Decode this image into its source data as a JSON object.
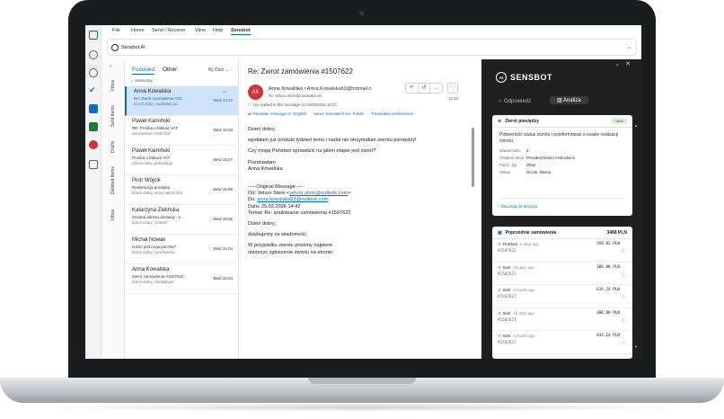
{
  "menubar": {
    "items": [
      "File",
      "Home",
      "Send / Receive",
      "View",
      "Help",
      "Sensbot"
    ],
    "active": "Sensbot"
  },
  "ribbon": {
    "button_label": "Sensbot AI"
  },
  "folders": [
    "Inbox",
    "Sent Items",
    "Drafts",
    "Deleted Items",
    "Inbox"
  ],
  "message_list": {
    "tab_focused": "Focused",
    "tab_other": "Other",
    "sort": "By Date ⌄",
    "group": "Yesterday",
    "items": [
      {
        "sender": "Anna Kowalska",
        "subject": "Re: Zwrot zamówienia #15...",
        "preview": "Dzień dobry, wysłałam juz",
        "date": "Wed 13:42"
      },
      {
        "sender": "Paweł Kamiński",
        "subject": "RE: Prośba o fakturę VAT",
        "preview": "zamówienie #1507301",
        "date": "Wed 15:08"
      },
      {
        "sender": "Paweł Kamiński",
        "subject": "Prośba o fakturę VAT",
        "preview": "Dzień dobry, potrzebuję",
        "date": "Wed 15:07"
      },
      {
        "sender": "Piotr Wójcik",
        "subject": "Reklamacja produktu",
        "preview": "Dzień dobry, otrzymałem dziś",
        "date": "Wed 15:06"
      },
      {
        "sender": "Katarzyna Zielińska",
        "subject": "Zmiana adresu dostawy - z...",
        "preview": "Dzień dobry, zmienić",
        "date": "Wed 15:05"
      },
      {
        "sender": "Michał Nowak",
        "subject": "Gdzie jest moja paczka?",
        "preview": "Dzień dobry, zamówienie",
        "date": "Wed 15:04"
      },
      {
        "sender": "Anna Kowalska",
        "subject": "Zwrot zamówienia #1507622",
        "preview": "Dzień dobry, chciałabym",
        "date": "Wed 15:04"
      }
    ]
  },
  "reading": {
    "subject": "Re: Zwrot zamówienia #1507622",
    "avatar_initials": "AK",
    "from": "Anna Kowalska <Anna.Kowalska63@hotmail.c",
    "to": "To: veluro.store@outlook.com",
    "time": "13:42",
    "replied_info": "You replied to this message on 04/03/2026 18:27.",
    "translate_link": "Translate message to: English",
    "never_translate": "Never translate from: Polish",
    "translation_prefs": "Translation preferences",
    "body": {
      "p1": "Dzień dobry,",
      "p2": "wysłałam już produkt tydzień temu i nadal nie otrzymałam zwrotu pieniędzy!",
      "p3": "Czy mogą Państwo sprawdzić na jakim etapie jest zwrot?",
      "p4a": "Pozdrawiam",
      "p4b": "Anna Kowalska",
      "orig_hdr": "-----Original Message-----",
      "od_label": "Od: Veluro Store <",
      "od_email": "veluro.store@outlook.com",
      "od_end": ">",
      "do_label": "Do: ",
      "do_email": "anna.kowalska63@outlook.com",
      "data": "Data: 25.02.2026 14:42",
      "temat": "Temat: Re: anulowanie zamówienia #1507622",
      "p5": "Dzień dobry,",
      "p6": "dziękujemy za wiadomość.",
      "p7a": "W przypadku zwrotu prosimy najpierw",
      "p7b": "utworzyć zgłoszenie zwrotu na stronie:"
    }
  },
  "sensbot": {
    "logo_mark": "AI",
    "logo_text": "SENSBOT",
    "tab_reply": "☆ Odpowiedz",
    "tab_analysis": "▥ Analiza",
    "card1": {
      "title": "Zwrot pieniędzy",
      "badge": "Niski",
      "text": "Potwierdzić status zwrotu i poinformować o czasie realizacji zwrotu.",
      "rows": [
        {
          "k": "Wiadomości",
          "v": "3"
        },
        {
          "k": "Ostatnia akcja",
          "v": "Provided Return instructions"
        },
        {
          "k": "Poprz. typ",
          "v": "Other"
        },
        {
          "k": "Status",
          "v": "Oczek. klienta"
        }
      ],
      "link": "Dlaczego ta decyzja"
    },
    "card2": {
      "title": "Poprzednie zamówienia",
      "total": "3488 PLN",
      "orders": [
        {
          "status": "Finished",
          "ago": "2 days ago",
          "num": "#1507622",
          "amount": "350.82 PLN"
        },
        {
          "status": "Sent",
          "ago": "19 days ago",
          "num": "#1507627",
          "amount": "306.88 PLN"
        },
        {
          "status": "Sent",
          "ago": "a month ago",
          "num": "#1507627",
          "amount": "634.24 PLN"
        },
        {
          "status": "Sent",
          "ago": "19 days ago",
          "num": "#1507627",
          "amount": "306.88 PLN"
        },
        {
          "status": "Sent",
          "ago": "a month ago",
          "num": "#1507627",
          "amount": "634.24 PLN"
        }
      ]
    }
  },
  "colors": {
    "accent": "#0f6cbd",
    "selected_row": "#cfe4fa",
    "avatar": "#d13438",
    "panel_bg": "#1f1f1f"
  }
}
